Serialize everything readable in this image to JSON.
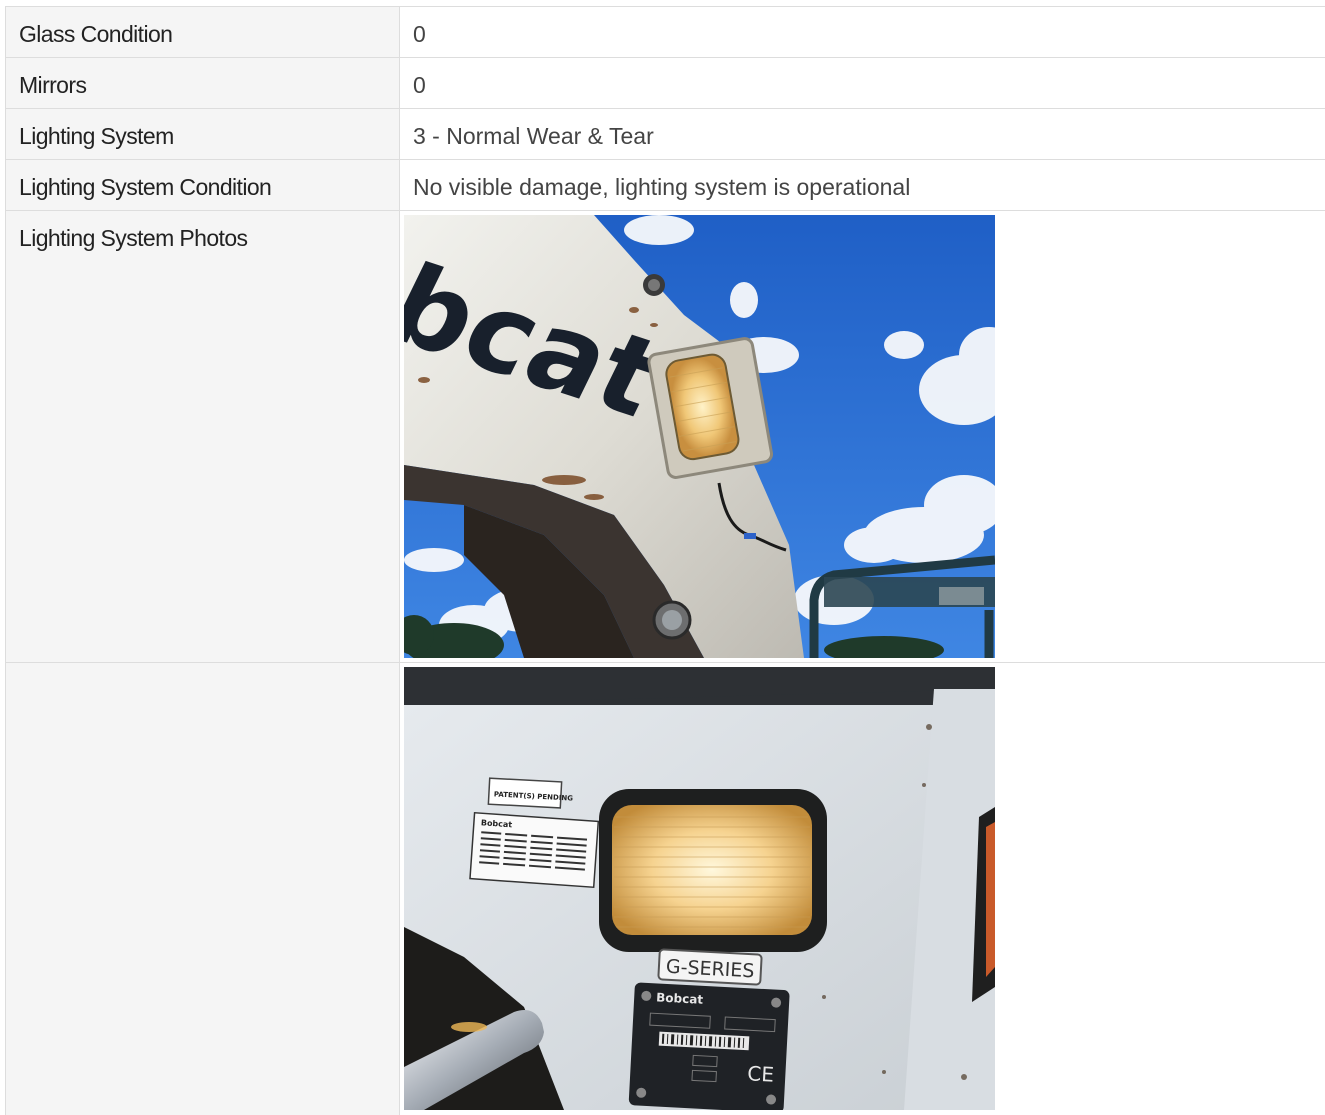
{
  "rows": [
    {
      "label": "Glass Condition",
      "value": "0"
    },
    {
      "label": "Mirrors",
      "value": "0"
    },
    {
      "label": "Lighting System",
      "value": "3 - Normal Wear & Tear"
    },
    {
      "label": "Lighting System Condition",
      "value": "No visible damage, lighting system is operational"
    }
  ],
  "photos": {
    "label": "Lighting System Photos",
    "photo1": {
      "brand_text": "bcat"
    },
    "photo2": {
      "decal_patent": "PATENT(S) PENDING",
      "decal_brand": "Bobcat",
      "badge_series": "G-SERIES",
      "plate_brand": "Bobcat",
      "plate_mark": "CE"
    }
  },
  "colors": {
    "label_bg": "#f5f5f5",
    "border": "#dddddd",
    "sky": "#2f6fd0"
  }
}
